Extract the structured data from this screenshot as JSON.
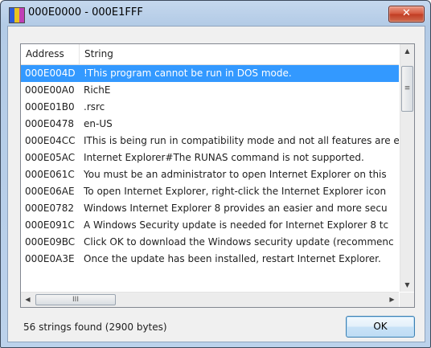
{
  "window": {
    "title": "000E0000 - 000E1FFF",
    "close_glyph": "✕"
  },
  "listview": {
    "columns": [
      "Address",
      "String"
    ],
    "rows": [
      {
        "address": "000E004D",
        "string": "!This program cannot be run in DOS mode.",
        "selected": true
      },
      {
        "address": "000E00A0",
        "string": "RichE"
      },
      {
        "address": "000E01B0",
        "string": ".rsrc"
      },
      {
        "address": "000E0478",
        "string": "en-US"
      },
      {
        "address": "000E04CC",
        "string": "IThis is being run in compatibility mode and not all features are e"
      },
      {
        "address": "000E05AC",
        "string": "Internet Explorer#The RUNAS command is not supported."
      },
      {
        "address": "000E061C",
        "string": "You must be an administrator to open Internet Explorer on this"
      },
      {
        "address": "000E06AE",
        "string": "To open Internet Explorer, right-click the Internet Explorer icon"
      },
      {
        "address": "000E0782",
        "string": "Windows Internet Explorer 8 provides an easier and more secu"
      },
      {
        "address": "000E091C",
        "string": "A Windows Security update is needed for Internet Explorer 8 tc"
      },
      {
        "address": "000E09BC",
        "string": "Click OK to download the Windows security update (recommenc"
      },
      {
        "address": "000E0A3E",
        "string": "Once the update has been installed, restart Internet Explorer."
      }
    ],
    "scroll_up_glyph": "▲",
    "scroll_down_glyph": "▼",
    "scroll_left_glyph": "◀",
    "scroll_right_glyph": "▶",
    "grip_glyph": "≡",
    "hgrip_glyph": "III"
  },
  "footer": {
    "status": "56 strings found (2900 bytes)",
    "ok_label": "OK"
  },
  "colors": {
    "selection": "#3399ff",
    "close_button": "#c9452a"
  }
}
